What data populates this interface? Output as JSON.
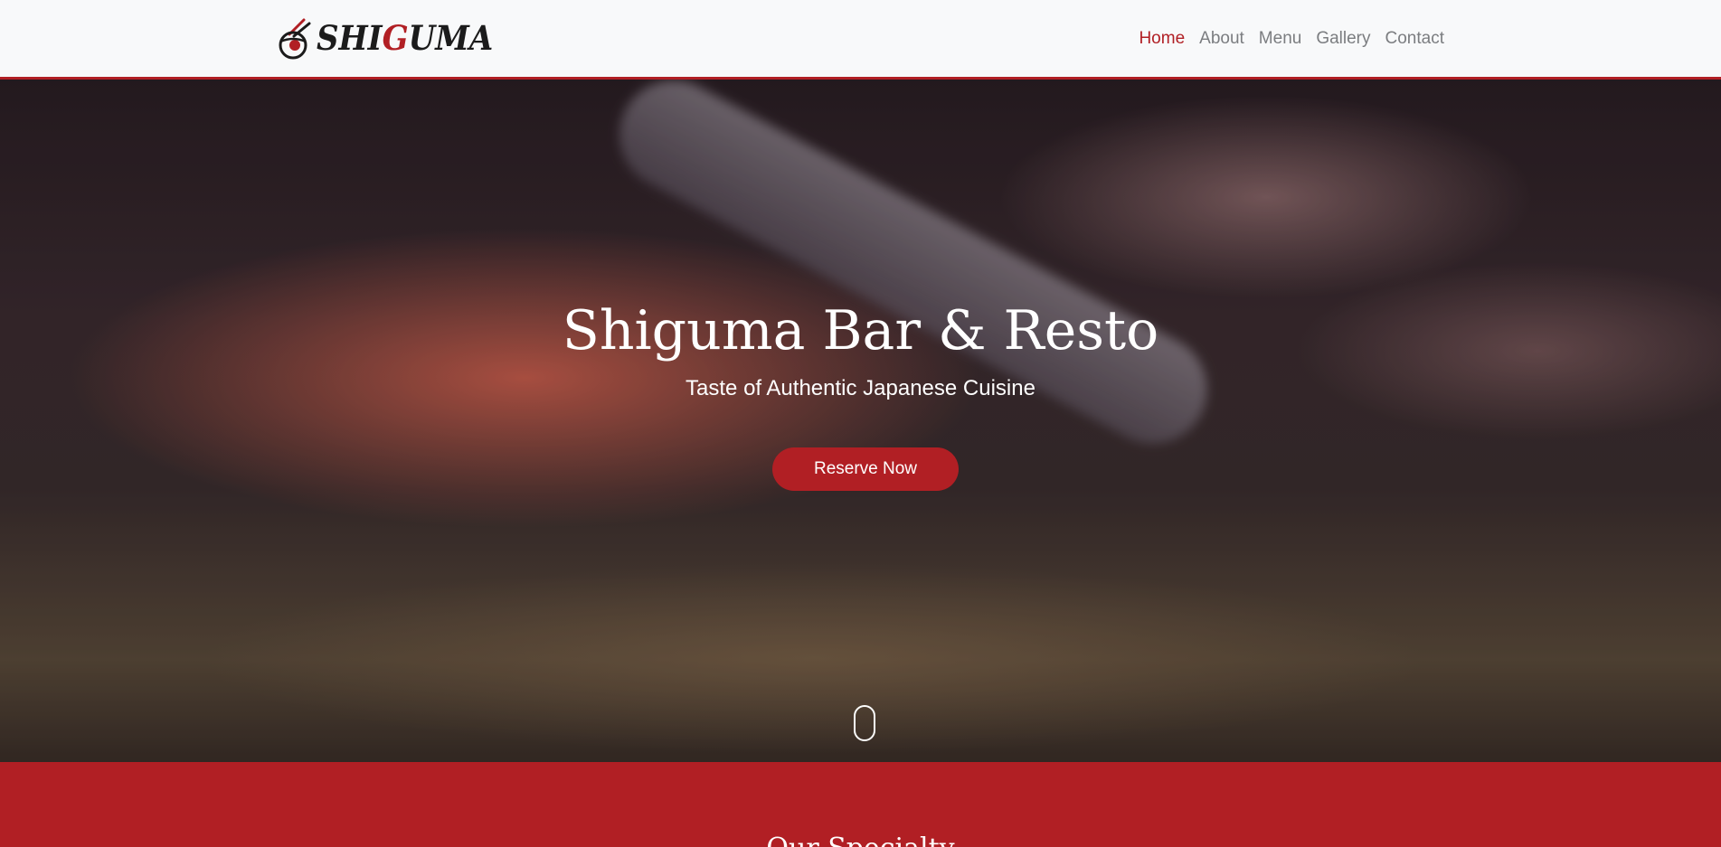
{
  "brand": {
    "logo_text_1": "SHI",
    "logo_text_2": "G",
    "logo_text_3": "UMA",
    "accent": "#b11f24"
  },
  "nav": {
    "items": [
      {
        "label": "Home",
        "active": true
      },
      {
        "label": "About"
      },
      {
        "label": "Menu"
      },
      {
        "label": "Gallery"
      },
      {
        "label": "Contact"
      }
    ]
  },
  "hero": {
    "title": "Shiguma Bar & Resto",
    "subtitle": "Taste of Authentic Japanese Cuisine",
    "cta_label": "Reserve Now",
    "scroll_icon": "mouse-scroll-icon"
  },
  "specialty": {
    "title": "Our Specialty",
    "bg": "#b11f24"
  }
}
